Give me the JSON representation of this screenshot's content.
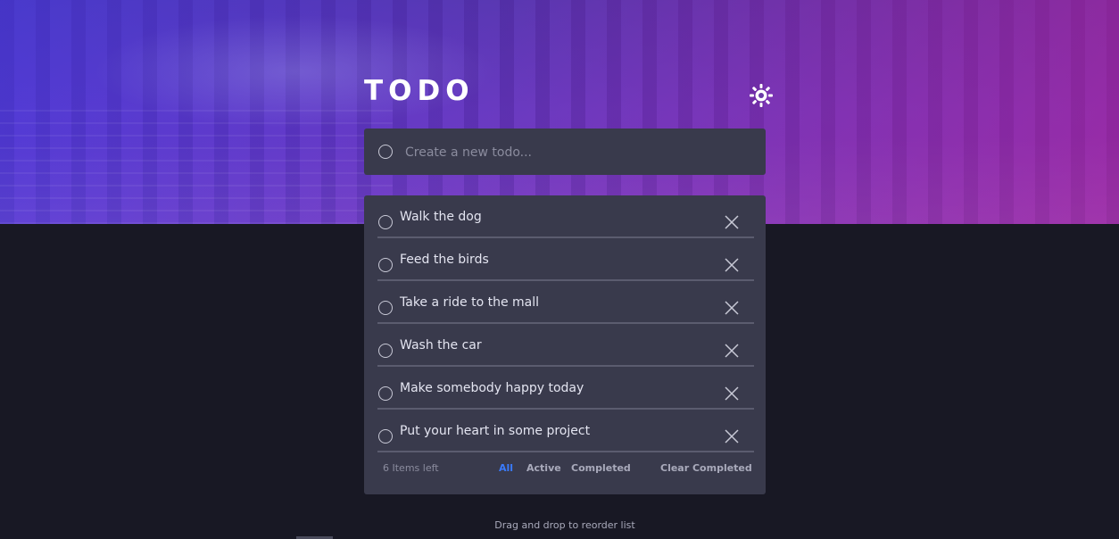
{
  "header": {
    "title": "TODO",
    "theme_toggle_icon": "sun-icon"
  },
  "new_todo": {
    "placeholder": "Create a new todo..."
  },
  "todos": [
    {
      "text": "Walk the dog",
      "completed": false
    },
    {
      "text": "Feed the birds",
      "completed": false
    },
    {
      "text": "Take a ride to the mall",
      "completed": false
    },
    {
      "text": "Wash the car",
      "completed": false
    },
    {
      "text": "Make somebody happy today",
      "completed": false
    },
    {
      "text": "Put your heart in some project",
      "completed": false
    }
  ],
  "footer": {
    "items_left": "6 Items left",
    "filters": [
      "All",
      "Active",
      "Completed"
    ],
    "active_filter": "All",
    "clear_label": "Clear Completed"
  },
  "hint": "Drag and drop to reorder list",
  "colors": {
    "accent": "#3a7bfd",
    "card": "#393a4c",
    "background": "#181824",
    "gradient_start": "#5b4ae8",
    "gradient_end": "#a23ab4"
  }
}
